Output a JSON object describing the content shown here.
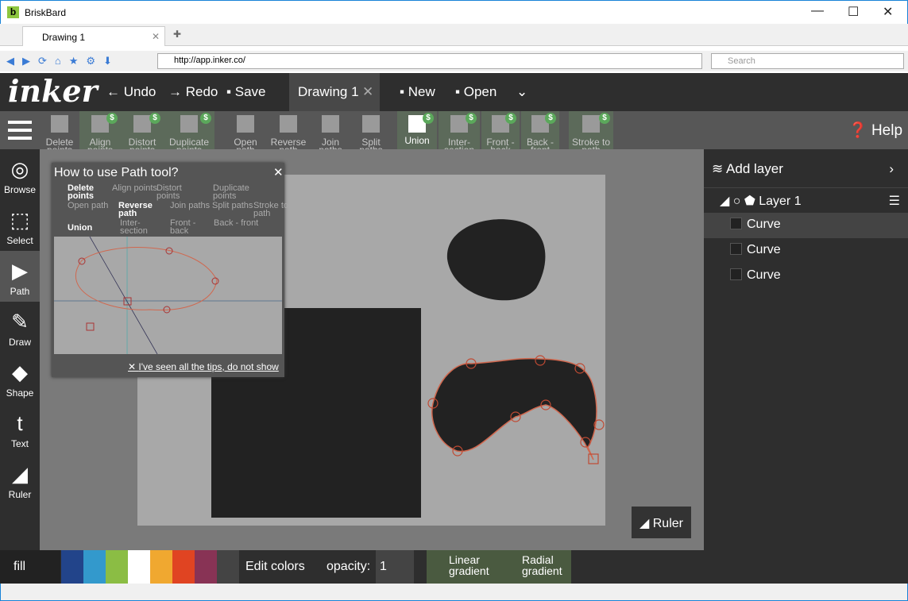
{
  "browser": {
    "title": "BriskBard",
    "tab": "Drawing 1",
    "url": "http://app.inker.co/",
    "search_placeholder": "Search"
  },
  "header": {
    "logo": "inker",
    "undo": "Undo",
    "redo": "Redo",
    "save": "Save",
    "doc_tab": "Drawing 1",
    "new": "New",
    "open": "Open",
    "help": "Help"
  },
  "toolbar": [
    {
      "label": "Delete points",
      "premium": false
    },
    {
      "label": "Align points",
      "premium": true
    },
    {
      "label": "Distort points",
      "premium": true
    },
    {
      "label": "Duplicate points",
      "premium": true
    },
    {
      "label": "Open path",
      "premium": false
    },
    {
      "label": "Reverse path",
      "premium": false
    },
    {
      "label": "Join paths",
      "premium": false
    },
    {
      "label": "Split paths",
      "premium": false
    },
    {
      "label": "Union",
      "premium": true
    },
    {
      "label": "Inter-section",
      "premium": true
    },
    {
      "label": "Front - back",
      "premium": true
    },
    {
      "label": "Back - front",
      "premium": true
    },
    {
      "label": "Stroke to path",
      "premium": true
    }
  ],
  "sidebar": [
    {
      "label": "Browse"
    },
    {
      "label": "Select"
    },
    {
      "label": "Path",
      "active": true
    },
    {
      "label": "Draw"
    },
    {
      "label": "Shape"
    },
    {
      "label": "Text"
    },
    {
      "label": "Ruler"
    }
  ],
  "popup": {
    "title": "How to use Path tool?",
    "items": [
      "Delete points",
      "Align points",
      "Distort points",
      "Duplicate points",
      "Open path",
      "Reverse path",
      "Join paths",
      "Split paths",
      "Stroke to path",
      "Union",
      "Inter-section",
      "Front - back",
      "Back - front"
    ],
    "dismiss": "I've seen all the tips, do not show"
  },
  "ruler_button": "Ruler",
  "layers": {
    "add": "Add layer",
    "layer": "Layer 1",
    "items": [
      "Curve",
      "Curve",
      "Curve"
    ]
  },
  "bottom": {
    "fill": "fill",
    "swatches": [
      "#22448a",
      "#3399cc",
      "#8bbd44",
      "#ffffff",
      "#f0a830",
      "#e04422",
      "#883355"
    ],
    "edit_colors": "Edit colors",
    "opacity_label": "opacity:",
    "opacity": "1",
    "linear": "Linear gradient",
    "radial": "Radial gradient"
  }
}
